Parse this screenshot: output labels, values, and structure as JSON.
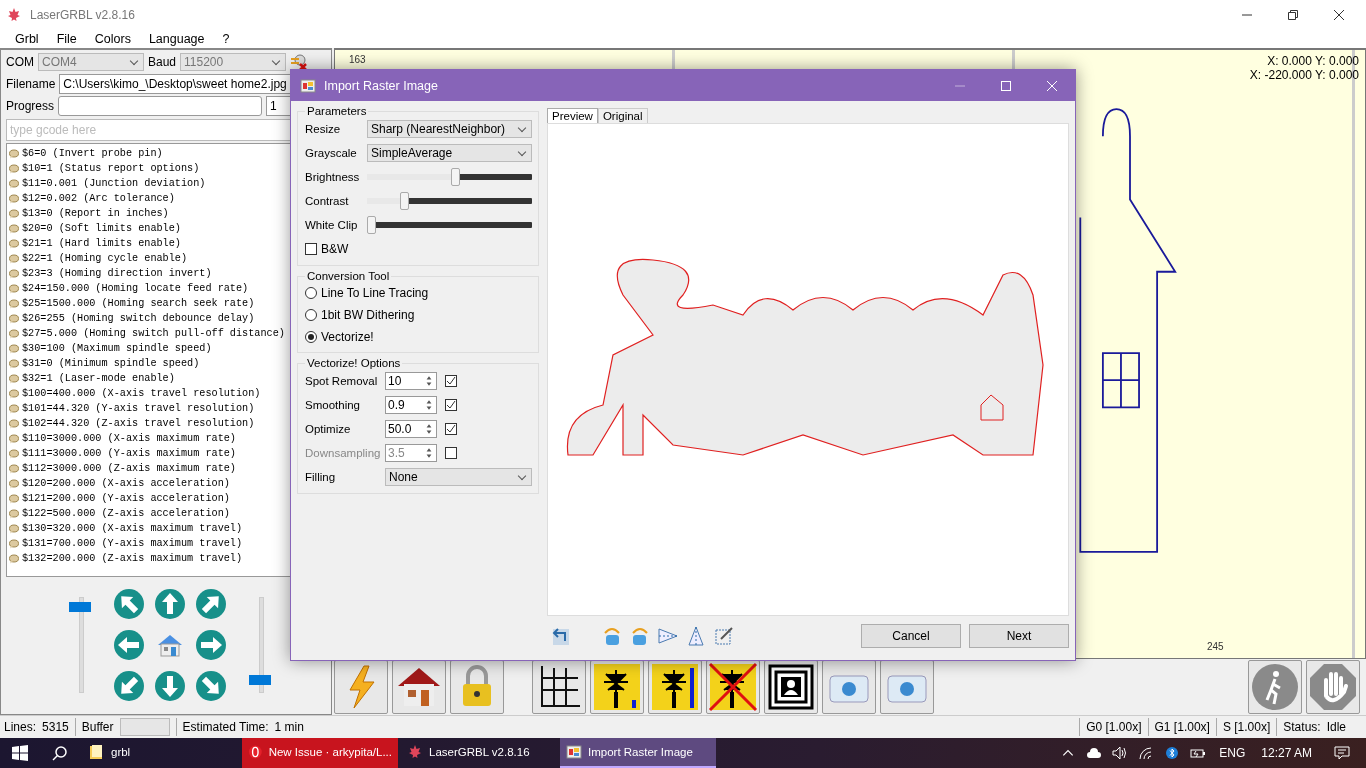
{
  "window": {
    "title": "LaserGRBL v2.8.16"
  },
  "menu": [
    "Grbl",
    "File",
    "Colors",
    "Language",
    "?"
  ],
  "connection": {
    "com_label": "COM",
    "com": "COM4",
    "baud_label": "Baud",
    "baud": "115200"
  },
  "filename": {
    "label": "Filename",
    "value": "C:\\Users\\kimo_\\Desktop\\sweet home2.jpg"
  },
  "progress": {
    "label": "Progress",
    "level": 0,
    "passes": "1"
  },
  "gcode_input": {
    "placeholder": "type gcode here"
  },
  "console": [
    "$6=0 (Invert probe pin)",
    "$10=1 (Status report options)",
    "$11=0.001 (Junction deviation)",
    "$12=0.002 (Arc tolerance)",
    "$13=0 (Report in inches)",
    "$20=0 (Soft limits enable)",
    "$21=1 (Hard limits enable)",
    "$22=1 (Homing cycle enable)",
    "$23=3 (Homing direction invert)",
    "$24=150.000 (Homing locate feed rate)",
    "$25=1500.000 (Homing search seek rate)",
    "$26=255 (Homing switch debounce delay)",
    "$27=5.000 (Homing switch pull-off distance)",
    "$30=100 (Maximum spindle speed)",
    "$31=0 (Minimum spindle speed)",
    "$32=1 (Laser-mode enable)",
    "$100=400.000 (X-axis travel resolution)",
    "$101=44.320 (Y-axis travel resolution)",
    "$102=44.320 (Z-axis travel resolution)",
    "$110=3000.000 (X-axis maximum rate)",
    "$111=3000.000 (Y-axis maximum rate)",
    "$112=3000.000 (Z-axis maximum rate)",
    "$120=200.000 (X-axis acceleration)",
    "$121=200.000 (Y-axis acceleration)",
    "$122=500.000 (Z-axis acceleration)",
    "$130=320.000 (X-axis maximum travel)",
    "$131=700.000 (Y-axis maximum travel)",
    "$132=200.000 (Z-axis maximum travel)"
  ],
  "jog": {
    "speed_slider": {
      "level": 0.97
    },
    "step_slider": {
      "level": 0.12
    }
  },
  "canvas": {
    "coords": [
      "X: 0.000 Y: 0.000",
      "X: -220.000 Y: 0.000"
    ],
    "top_ruler": "163",
    "bottom_ruler": "245"
  },
  "dialog": {
    "title": "Import Raster Image",
    "parameters": {
      "title": "Parameters",
      "resize_label": "Resize",
      "resize": "Sharp (NearestNeighbor)",
      "grayscale_label": "Grayscale",
      "grayscale": "SimpleAverage",
      "sliders": [
        {
          "label": "Brightness",
          "level": 0.54
        },
        {
          "label": "Contrast",
          "level": 0.21
        },
        {
          "label": "White Clip",
          "level": 0.0
        }
      ],
      "bw": {
        "label": "B&W",
        "checked": false
      }
    },
    "conversion": {
      "title": "Conversion Tool",
      "options": [
        {
          "label": "Line To Line Tracing",
          "selected": false
        },
        {
          "label": "1bit BW Dithering",
          "selected": false
        },
        {
          "label": "Vectorize!",
          "selected": true
        }
      ]
    },
    "vectorize": {
      "title": "Vectorize! Options",
      "rows": [
        {
          "label": "Spot Removal",
          "value": "10",
          "checked": true,
          "disabled": false
        },
        {
          "label": "Smoothing",
          "value": "0.9",
          "checked": true,
          "disabled": false
        },
        {
          "label": "Optimize",
          "value": "50.0",
          "checked": true,
          "disabled": false
        },
        {
          "label": "Downsampling",
          "value": "3.5",
          "checked": false,
          "disabled": true
        }
      ],
      "filling_label": "Filling",
      "filling": "None"
    },
    "tabs": [
      {
        "label": "Preview",
        "selected": true
      },
      {
        "label": "Original",
        "selected": false
      }
    ],
    "buttons": [
      "Cancel",
      "Next"
    ]
  },
  "status_bar": {
    "lines_label": "Lines:",
    "lines": "5315",
    "buffer_label": "Buffer",
    "estimated_label": "Estimated Time:",
    "estimated": "1 min",
    "overrides": [
      "G0 [1.00x]",
      "G1 [1.00x]",
      "S [1.00x]"
    ],
    "status_label": "Status:",
    "status": "Idle"
  },
  "taskbar": {
    "items": [
      {
        "label": "grbl",
        "kind": "folder",
        "selected": false,
        "flashing": false
      },
      {
        "label": "New Issue · arkypita/L...",
        "kind": "browser",
        "selected": false,
        "flashing": true
      },
      {
        "label": "LaserGRBL v2.8.16",
        "kind": "laser",
        "selected": false,
        "flashing": false
      },
      {
        "label": "Import Raster Image",
        "kind": "dialog",
        "selected": true,
        "flashing": false
      }
    ],
    "language": "ENG",
    "time": "12:27 AM"
  }
}
